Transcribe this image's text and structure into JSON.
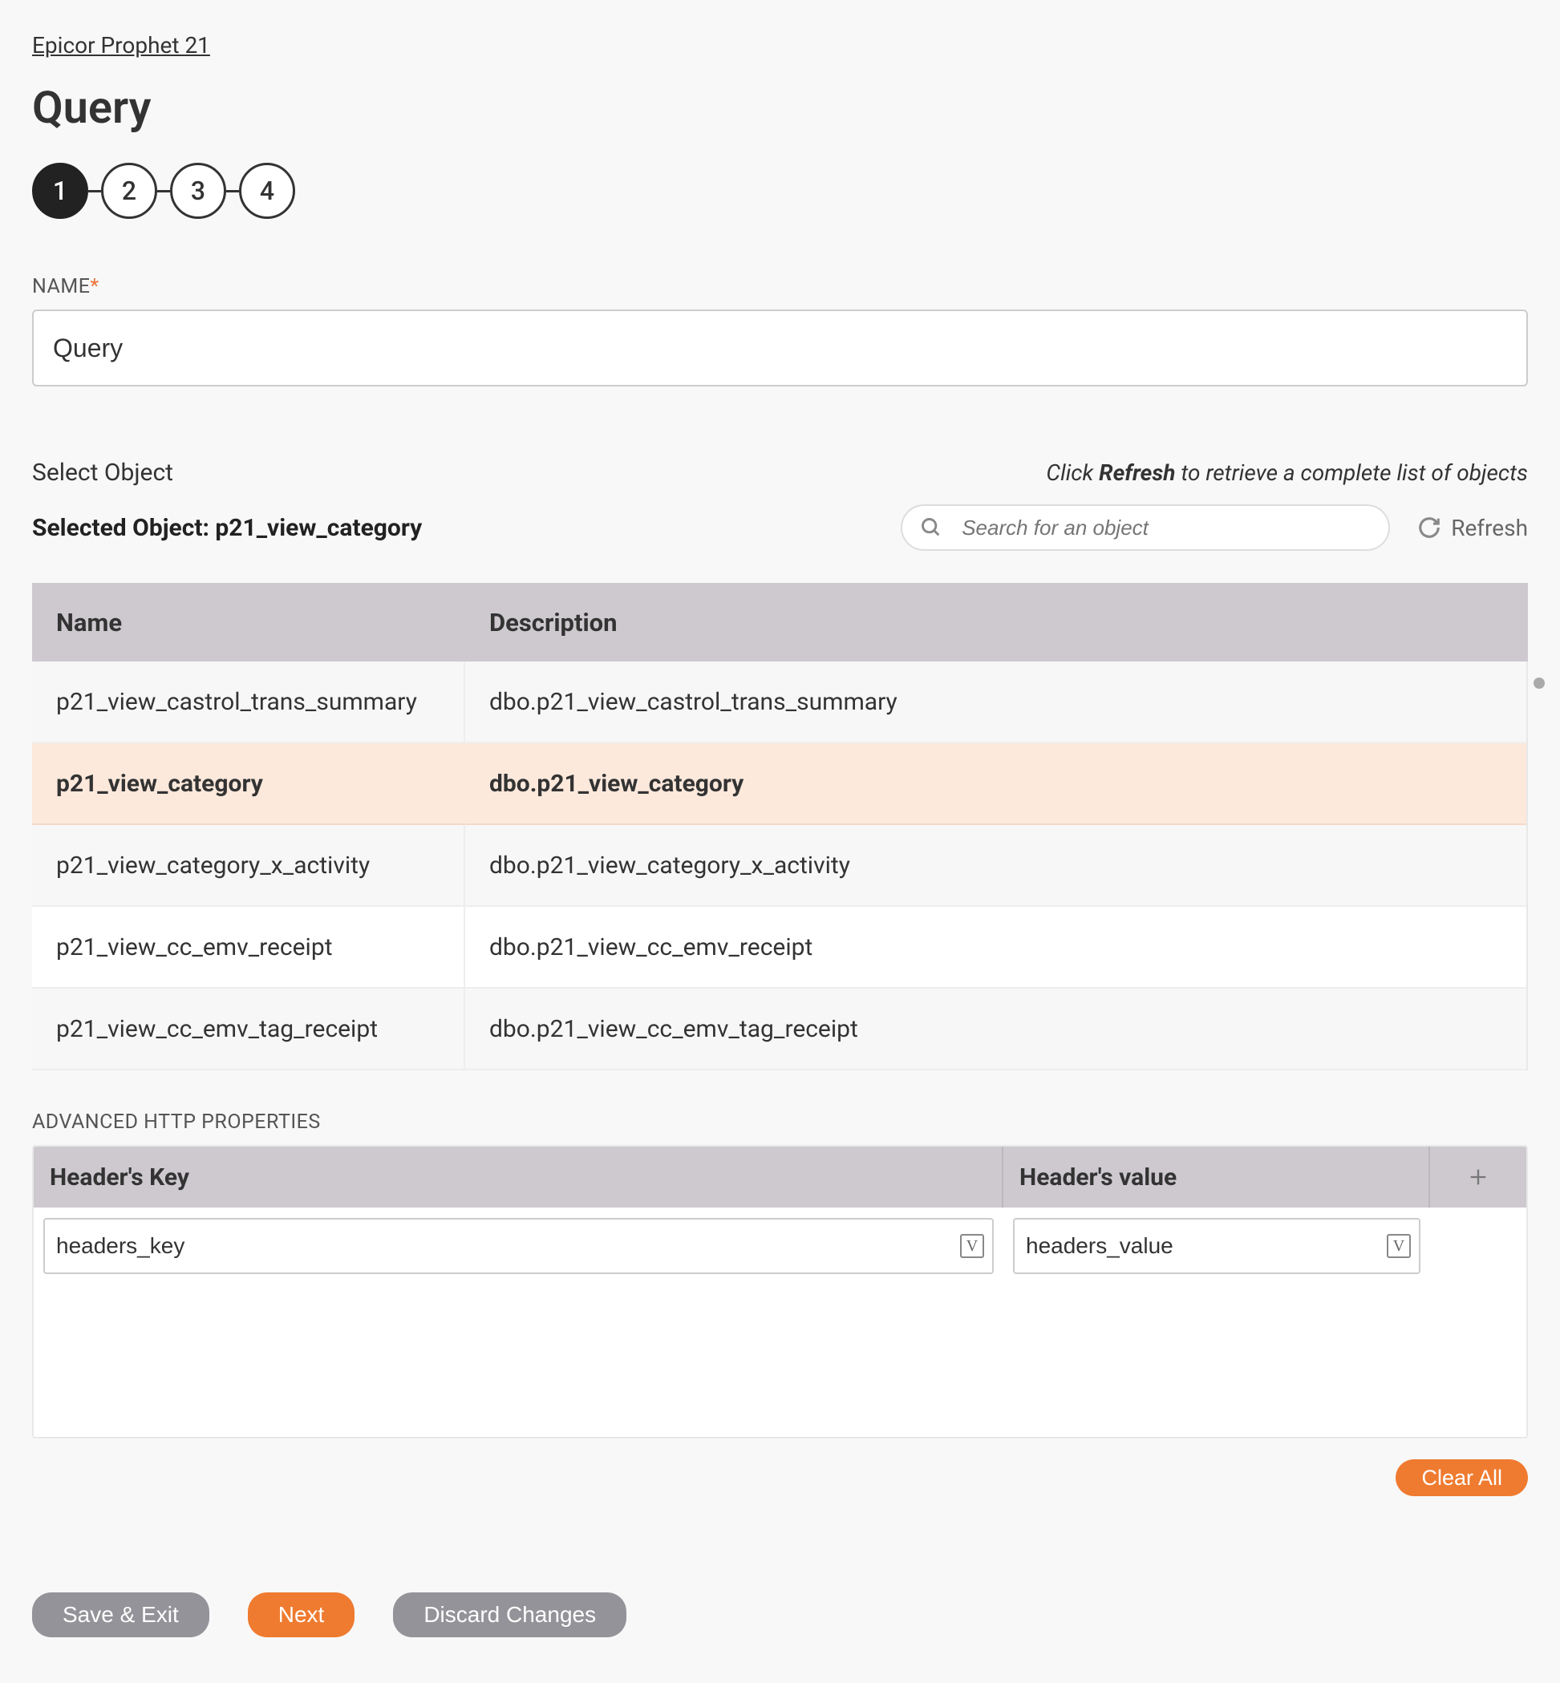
{
  "breadcrumb": "Epicor Prophet 21",
  "pageTitle": "Query",
  "steps": [
    "1",
    "2",
    "3",
    "4"
  ],
  "activeStep": 0,
  "nameField": {
    "label": "NAME",
    "required": "*",
    "value": "Query"
  },
  "selectSection": {
    "label": "Select Object",
    "hintPrefix": "Click ",
    "hintStrong": "Refresh",
    "hintSuffix": " to retrieve a complete list of objects",
    "selectedPrefix": "Selected Object: ",
    "selectedValue": "p21_view_category",
    "searchPlaceholder": "Search for an object",
    "refreshLabel": "Refresh"
  },
  "table": {
    "headers": {
      "name": "Name",
      "description": "Description"
    },
    "selectedIndex": 1,
    "rows": [
      {
        "name": "p21_view_castrol_trans_summary",
        "description": "dbo.p21_view_castrol_trans_summary"
      },
      {
        "name": "p21_view_category",
        "description": "dbo.p21_view_category"
      },
      {
        "name": "p21_view_category_x_activity",
        "description": "dbo.p21_view_category_x_activity"
      },
      {
        "name": "p21_view_cc_emv_receipt",
        "description": "dbo.p21_view_cc_emv_receipt"
      },
      {
        "name": "p21_view_cc_emv_tag_receipt",
        "description": "dbo.p21_view_cc_emv_tag_receipt"
      }
    ]
  },
  "advanced": {
    "label": "ADVANCED HTTP PROPERTIES",
    "headers": {
      "key": "Header's Key",
      "value": "Header's value"
    },
    "row": {
      "key": "headers_key",
      "value": "headers_value",
      "badge": "V"
    }
  },
  "buttons": {
    "clearAll": "Clear All",
    "saveExit": "Save & Exit",
    "next": "Next",
    "discard": "Discard Changes"
  }
}
